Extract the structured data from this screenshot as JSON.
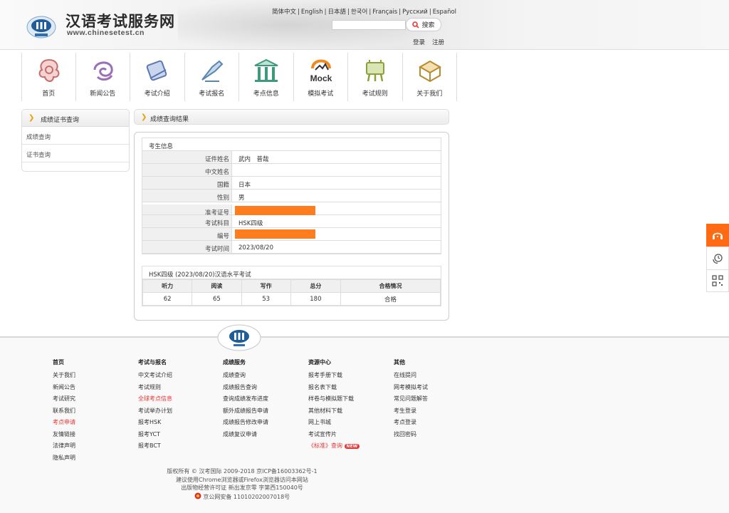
{
  "header": {
    "site_title": "汉语考试服务网",
    "site_url": "www.chinesetest.cn",
    "languages": [
      "简体中文",
      "English",
      "日本語",
      "한국어",
      "Français",
      "Русский",
      "Español"
    ],
    "search_button": "搜索",
    "login": "登录",
    "register": "注册"
  },
  "nav": {
    "items": [
      {
        "label": "首页",
        "icon": "home-knot-icon"
      },
      {
        "label": "新闻公告",
        "icon": "news-swirl-icon"
      },
      {
        "label": "考试介绍",
        "icon": "scroll-icon"
      },
      {
        "label": "考试报名",
        "icon": "register-quill-icon"
      },
      {
        "label": "考点信息",
        "icon": "temple-icon"
      },
      {
        "label": "模拟考试",
        "icon": "mock-icon"
      },
      {
        "label": "考试规则",
        "icon": "cauldron-icon"
      },
      {
        "label": "关于我们",
        "icon": "box-icon"
      }
    ]
  },
  "sidebar": {
    "title": "成绩证书查询",
    "items": [
      "成绩查询",
      "证书查询"
    ]
  },
  "main": {
    "title": "成绩查询结果"
  },
  "info": {
    "title": "考生信息",
    "rows": [
      {
        "k": "证件姓名",
        "v": "武内　普哉"
      },
      {
        "k": "中文姓名",
        "v": ""
      },
      {
        "k": "国籍",
        "v": "日本"
      },
      {
        "k": "性别",
        "v": "男"
      },
      {
        "k": "准考证号",
        "v": ""
      },
      {
        "k": "考试科目",
        "v": "HSK四级"
      },
      {
        "k": "编号",
        "v": ""
      },
      {
        "k": "考试时间",
        "v": "2023/08/20"
      }
    ]
  },
  "score": {
    "title": "HSK四级 (2023/08/20)汉语水平考试",
    "headers": [
      "听力",
      "阅读",
      "写作",
      "总分",
      "合格情况"
    ],
    "values": [
      "62",
      "65",
      "53",
      "180",
      "合格"
    ]
  },
  "footer": {
    "cols": [
      {
        "h": "首页",
        "items": [
          "关于我们",
          "新闻公告",
          "考试研究",
          "联系我们",
          "考点申请",
          "友情链接",
          "法律声明",
          "隐私声明"
        ]
      },
      {
        "h": "考试与报名",
        "items": [
          "中文考试介绍",
          "考试规则",
          "全球考点信息",
          "考试举办计划",
          "报考HSK",
          "报考YCT",
          "报考BCT"
        ]
      },
      {
        "h": "成绩服务",
        "items": [
          "成绩查询",
          "成绩报告查询",
          "查询成绩发布进度",
          "额外成绩报告申请",
          "成绩报告修改申请",
          "成绩复议申请"
        ]
      },
      {
        "h": "资源中心",
        "items": [
          "报考手册下载",
          "报名表下载",
          "样卷与模拟题下载",
          "其他材料下载",
          "网上书城",
          "考试宣传片",
          "《标准》查询"
        ]
      },
      {
        "h": "其他",
        "items": [
          "在线提问",
          "网考模拟考试",
          "常见问题解答",
          "考生登录",
          "考点登录",
          "找回密码"
        ]
      }
    ],
    "new_badge": "NEW",
    "copyright_1": "版权所有 © 汉考国际 2009-2018  京ICP备16003362号-1",
    "copyright_2": "建议使用Chrome浏览器或Firefox浏览器访问本网站",
    "copyright_3": "出版物经营许可证  新出发京零 字第西150040号",
    "copyright_4": "京公网安备 11010202007018号"
  },
  "colors": {
    "accent": "#ff6a13",
    "redact": "#ff7d1e",
    "link_red": "#e33333"
  }
}
